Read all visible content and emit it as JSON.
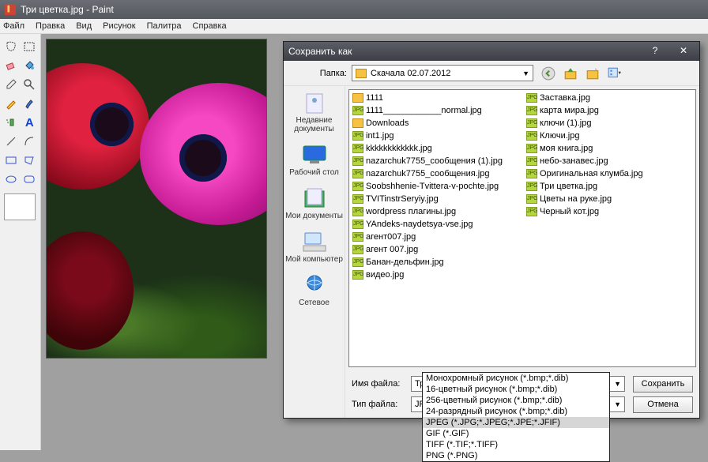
{
  "app": {
    "title": "Три цветка.jpg - Paint"
  },
  "menu": {
    "items": [
      "Файл",
      "Правка",
      "Вид",
      "Рисунок",
      "Палитра",
      "Справка"
    ]
  },
  "dialog": {
    "title": "Сохранить как",
    "help": "?",
    "close": "✕",
    "folder_label": "Папка:",
    "folder_value": "Скачала 02.07.2012",
    "places": [
      {
        "label": "Недавние документы"
      },
      {
        "label": "Рабочий стол"
      },
      {
        "label": "Мои документы"
      },
      {
        "label": "Мой компьютер"
      },
      {
        "label": "Сетевое"
      }
    ],
    "files_col1": [
      {
        "name": "1111",
        "type": "folder"
      },
      {
        "name": "1111____________normal.jpg",
        "type": "jpg"
      },
      {
        "name": "Downloads",
        "type": "folder"
      },
      {
        "name": "int1.jpg",
        "type": "jpg"
      },
      {
        "name": "kkkkkkkkkkkk.jpg",
        "type": "jpg"
      },
      {
        "name": "nazarchuk7755_сообщения (1).jpg",
        "type": "jpg"
      },
      {
        "name": "nazarchuk7755_сообщения.jpg",
        "type": "jpg"
      },
      {
        "name": "Soobshhenie-Tvittera-v-pochte.jpg",
        "type": "jpg"
      },
      {
        "name": "TVITinstrSeryiy.jpg",
        "type": "jpg"
      },
      {
        "name": "wordpress плагины.jpg",
        "type": "jpg"
      },
      {
        "name": "YAndeks-naydetsya-vse.jpg",
        "type": "jpg"
      },
      {
        "name": "агент007.jpg",
        "type": "jpg"
      },
      {
        "name": "агент 007.jpg",
        "type": "jpg"
      },
      {
        "name": "Банан-дельфин.jpg",
        "type": "jpg"
      },
      {
        "name": "видео.jpg",
        "type": "jpg"
      }
    ],
    "files_col2": [
      {
        "name": "Заставка.jpg",
        "type": "jpg"
      },
      {
        "name": "карта мира.jpg",
        "type": "jpg"
      },
      {
        "name": "ключи (1).jpg",
        "type": "jpg"
      },
      {
        "name": "Ключи.jpg",
        "type": "jpg"
      },
      {
        "name": "моя книга.jpg",
        "type": "jpg"
      },
      {
        "name": "небо-занавес.jpg",
        "type": "jpg"
      },
      {
        "name": "Оригинальная клумба.jpg",
        "type": "jpg"
      },
      {
        "name": "Три цветка.jpg",
        "type": "jpg"
      },
      {
        "name": "Цветы на руке.jpg",
        "type": "jpg"
      },
      {
        "name": "Черный кот.jpg",
        "type": "jpg"
      }
    ],
    "filename_label": "Имя файла:",
    "filename_value": "Три цветка",
    "filetype_label": "Тип файла:",
    "filetype_value": "JPEG (*.JPG;*.JPEG;*.JPE;*.JFIF)",
    "save_label": "Сохранить",
    "cancel_label": "Отмена",
    "dropdown_options": [
      "Монохромный рисунок (*.bmp;*.dib)",
      "16-цветный рисунок (*.bmp;*.dib)",
      "256-цветный рисунок (*.bmp;*.dib)",
      "24-разрядный рисунок (*.bmp;*.dib)",
      "JPEG (*.JPG;*.JPEG;*.JPE;*.JFIF)",
      "GIF (*.GIF)",
      "TIFF (*.TIF;*.TIFF)",
      "PNG (*.PNG)"
    ],
    "dropdown_selected_index": 4
  }
}
